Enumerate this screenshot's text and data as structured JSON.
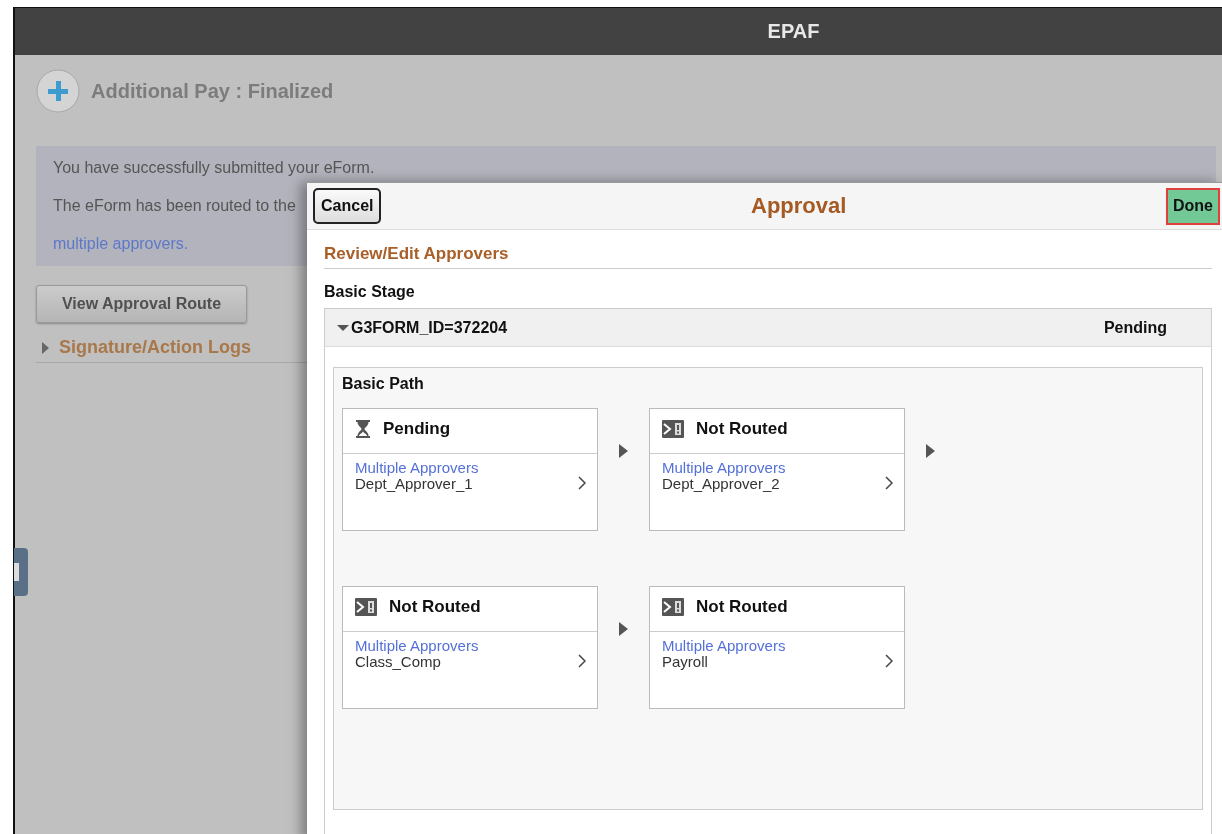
{
  "header": {
    "title": "EPAF"
  },
  "page": {
    "title": "Additional Pay :  Finalized",
    "messages": [
      {
        "kind": "text",
        "text": "You have successfully submitted your eForm."
      },
      {
        "kind": "text",
        "text": "The eForm has been routed to the"
      },
      {
        "kind": "link",
        "text": "multiple approvers."
      }
    ],
    "view_button": "View Approval Route",
    "logs": {
      "label": "Signature/Action Logs",
      "expanded": false
    }
  },
  "modal": {
    "title": "Approval",
    "cancel": "Cancel",
    "done": "Done",
    "section": "Review/Edit Approvers",
    "stage_label": "Basic Stage",
    "stage": {
      "id": "G3FORM_ID=372204",
      "status": "Pending",
      "expanded": true
    },
    "path": {
      "title": "Basic Path",
      "rows": [
        [
          {
            "kind": "pending",
            "status": "Pending",
            "link": "Multiple Approvers",
            "name": "Dept_Approver_1",
            "arrow_after": true
          },
          {
            "kind": "not_routed",
            "status": "Not Routed",
            "link": "Multiple Approvers",
            "name": "Dept_Approver_2",
            "arrow_after": true
          }
        ],
        [
          {
            "kind": "not_routed",
            "status": "Not Routed",
            "link": "Multiple Approvers",
            "name": "Class_Comp",
            "arrow_after": true
          },
          {
            "kind": "not_routed",
            "status": "Not Routed",
            "link": "Multiple Approvers",
            "name": "Payroll",
            "arrow_after": false
          }
        ]
      ]
    }
  }
}
